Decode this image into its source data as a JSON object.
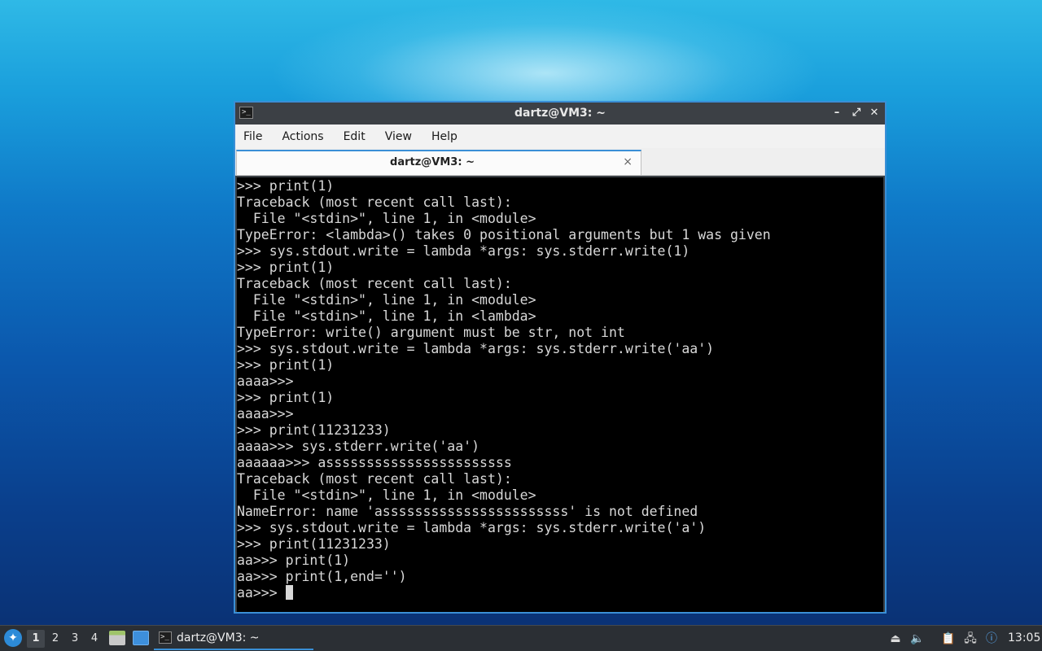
{
  "window": {
    "title": "dartz@VM3: ~",
    "icon": "terminal-icon",
    "controls": {
      "minimize": "–",
      "maximize": "⤢",
      "close": "✕"
    }
  },
  "menubar": {
    "items": [
      "File",
      "Actions",
      "Edit",
      "View",
      "Help"
    ]
  },
  "tab": {
    "label": "dartz@VM3: ~",
    "close": "×"
  },
  "terminal": {
    "lines": [
      ">>> print(1)",
      "Traceback (most recent call last):",
      "  File \"<stdin>\", line 1, in <module>",
      "TypeError: <lambda>() takes 0 positional arguments but 1 was given",
      ">>> sys.stdout.write = lambda *args: sys.stderr.write(1)",
      ">>> print(1)",
      "Traceback (most recent call last):",
      "  File \"<stdin>\", line 1, in <module>",
      "  File \"<stdin>\", line 1, in <lambda>",
      "TypeError: write() argument must be str, not int",
      ">>> sys.stdout.write = lambda *args: sys.stderr.write('aa')",
      ">>> print(1)",
      "aaaa>>>",
      ">>> print(1)",
      "aaaa>>>",
      ">>> print(11231233)",
      "aaaa>>> sys.stderr.write('aa')",
      "aaaaaa>>> asssssssssssssssssssssss",
      "Traceback (most recent call last):",
      "  File \"<stdin>\", line 1, in <module>",
      "NameError: name 'asssssssssssssssssssssss' is not defined",
      ">>> sys.stdout.write = lambda *args: sys.stderr.write('a')",
      ">>> print(11231233)",
      "aa>>> print(1)",
      "aa>>> print(1,end='')"
    ],
    "prompt": "aa>>> "
  },
  "taskbar": {
    "start_icon": "lxqt-menu-icon",
    "workspaces": [
      "1",
      "2",
      "3",
      "4"
    ],
    "active_workspace": "1",
    "launchers": [
      "file-manager-icon",
      "desktop-icon"
    ],
    "task": {
      "label": "dartz@VM3: ~",
      "icon": "terminal-icon"
    },
    "tray": [
      "eject-icon",
      "volume-icon",
      "clipboard-icon",
      "network-icon",
      "update-notifier-icon"
    ],
    "clock": "13:05"
  },
  "colors": {
    "accent": "#3a8fd6",
    "titlebar": "#3c4045",
    "terminal_bg": "#000000",
    "terminal_fg": "#d8d8d8",
    "taskbar": "#2b2f34"
  }
}
